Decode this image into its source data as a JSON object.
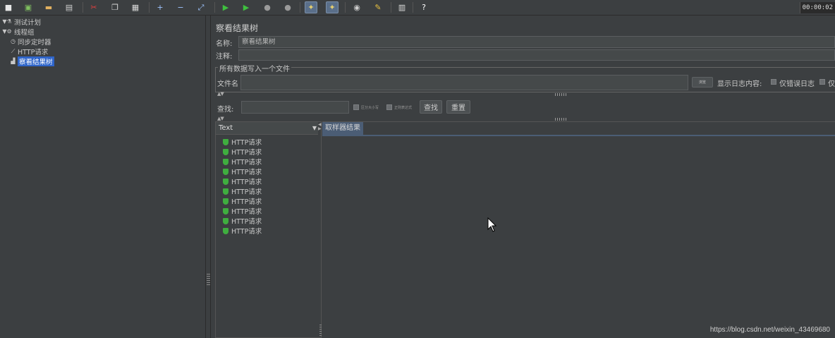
{
  "timer": "00:00:02",
  "toolbar": [
    {
      "icon": "new-icon",
      "glyph": "■",
      "color": "#e8e8e8"
    },
    {
      "icon": "templates-icon",
      "glyph": "▣",
      "color": "#7fbf5f"
    },
    {
      "icon": "open-icon",
      "glyph": "▬",
      "color": "#e0b060"
    },
    {
      "icon": "save-icon",
      "glyph": "▤",
      "color": "#d0d0d0"
    },
    {
      "icon": "cut-icon",
      "glyph": "✂",
      "color": "#e04040"
    },
    {
      "icon": "copy-icon",
      "glyph": "❐",
      "color": "#d8d8d8"
    },
    {
      "icon": "paste-icon",
      "glyph": "▦",
      "color": "#d8d8d8"
    },
    {
      "icon": "expand-icon",
      "glyph": "+",
      "color": "#9ec4ff"
    },
    {
      "icon": "collapse-icon",
      "glyph": "−",
      "color": "#9ec4ff"
    },
    {
      "icon": "toggle-icon",
      "glyph": "⤢",
      "color": "#9ec4ff"
    },
    {
      "icon": "start-icon",
      "glyph": "▶",
      "color": "#3fbf3f"
    },
    {
      "icon": "start-no-pause-icon",
      "glyph": "▶",
      "color": "#3fbf3f"
    },
    {
      "icon": "stop-icon",
      "glyph": "●",
      "color": "#9a9a9a"
    },
    {
      "icon": "shutdown-icon",
      "glyph": "●",
      "color": "#9a9a9a"
    },
    {
      "icon": "clear-icon",
      "glyph": "✦",
      "color": "#e6d070"
    },
    {
      "icon": "clear-all-icon",
      "glyph": "✦",
      "color": "#e6d070"
    },
    {
      "icon": "search-icon",
      "glyph": "◉",
      "color": "#cccccc"
    },
    {
      "icon": "reset-search-icon",
      "glyph": "✎",
      "color": "#e6c040"
    },
    {
      "icon": "function-helper-icon",
      "glyph": "▥",
      "color": "#dddddd"
    },
    {
      "icon": "help-icon",
      "glyph": "?",
      "color": "#ffffff"
    }
  ],
  "tree": [
    {
      "label": "测试计划",
      "icon": "test-plan-icon",
      "glyph": "▼⚗",
      "selected": false
    },
    {
      "label": "线程组",
      "icon": "thread-group-icon",
      "glyph": "▼⚙",
      "selected": false
    },
    {
      "label": "同步定时器",
      "icon": "timer-icon",
      "glyph": "◷",
      "selected": false
    },
    {
      "label": "HTTP请求",
      "icon": "sampler-icon",
      "glyph": "⟋",
      "selected": false
    },
    {
      "label": "察看结果树",
      "icon": "listener-icon",
      "glyph": "▟",
      "selected": true
    }
  ],
  "panel": {
    "title": "察看结果树",
    "name_label": "名称:",
    "name_value": "察看结果树",
    "comment_label": "注释:",
    "comment_value": "",
    "file_group_title": "所有数据写入一个文件",
    "filename_label": "文件名",
    "filename_value": "",
    "browse_label": "浏览",
    "log_display_label": "显示日志内容:",
    "errors_only_label": "仅错误日志",
    "success_only_label": "仅",
    "search_label": "查找:",
    "search_value": "",
    "case_sensitive_label": "区分大小写",
    "regex_label": "正则表达式",
    "find_button": "查找",
    "reset_button": "重置"
  },
  "results": {
    "renderer": "Text",
    "items": [
      "HTTP请求",
      "HTTP请求",
      "HTTP请求",
      "HTTP请求",
      "HTTP请求",
      "HTTP请求",
      "HTTP请求",
      "HTTP请求",
      "HTTP请求",
      "HTTP请求"
    ],
    "tab_label": "取样器结果"
  },
  "watermark": "https://blog.csdn.net/weixin_43469680"
}
